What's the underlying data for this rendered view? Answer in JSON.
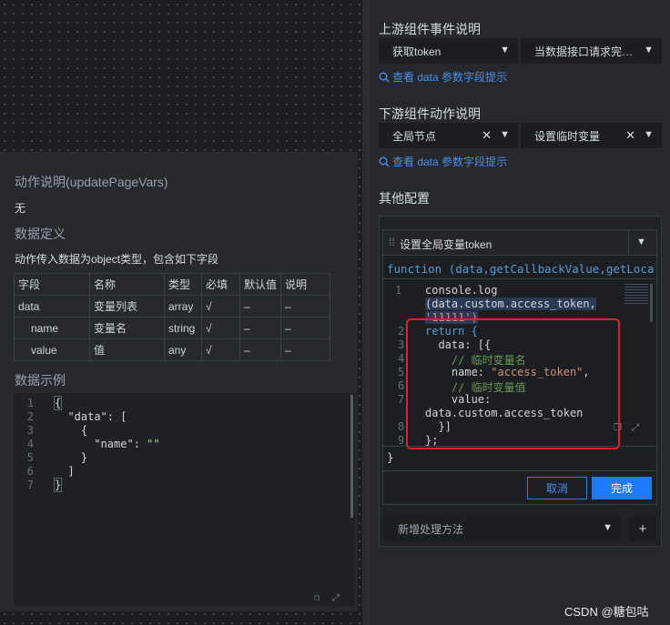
{
  "upstream": {
    "title": "上游组件事件说明",
    "select1": "获取token",
    "select2": "当数据接口请求完…",
    "link": "查看 data 参数字段提示"
  },
  "downstream": {
    "title": "下游组件动作说明",
    "select1": "全局节点",
    "select2": "设置临时变量",
    "link": "查看 data 参数字段提示"
  },
  "other": {
    "title": "其他配置",
    "editor_title": "设置全局变量token",
    "signature": "function (data,getCallbackValue,getLocalV",
    "closing_brace": "}",
    "cancel": "取消",
    "confirm": "完成",
    "add_method": "新增处理方法",
    "add_symbol": "+"
  },
  "code": {
    "line_numbers": [
      "1",
      "2",
      "3",
      "4",
      "5",
      "6",
      "7",
      "8",
      "9"
    ],
    "l1a": "console.log",
    "l1b": "(data.custom.access_token,",
    "l1c": "'11111')",
    "l2": "return {",
    "l3": "  data: [{",
    "l4": "    // 临时变量名",
    "l5a": "    name: ",
    "l5b": "\"access_token\"",
    "l5c": ",",
    "l6": "    // 临时变量值",
    "l7a": "    value:",
    "l7b": "data.custom.access_token",
    "l8": "  }]",
    "l9": "};"
  },
  "doc": {
    "action_title": "动作说明(updatePageVars)",
    "action_desc": "无",
    "def_title": "数据定义",
    "def_desc": "动作传入数据为object类型，包含如下字段",
    "headers": [
      "字段",
      "名称",
      "类型",
      "必填",
      "默认值",
      "说明"
    ],
    "rows": [
      [
        "data",
        "变量列表",
        "array",
        "√",
        "–",
        "–"
      ],
      [
        "name",
        "变量名",
        "string",
        "√",
        "–",
        "–"
      ],
      [
        "value",
        "值",
        "any",
        "√",
        "–",
        "–"
      ]
    ],
    "example_title": "数据示例",
    "example_lines": [
      "1",
      "2",
      "3",
      "4",
      "5",
      "6",
      "7"
    ],
    "ex1": "{",
    "ex2a": "  \"data\"",
    "ex2b": ": [",
    "ex3": "    {",
    "ex4a": "      \"name\"",
    "ex4b": ": ",
    "ex4c": "\"\"",
    "ex5": "    }",
    "ex6": "  ]",
    "ex7": "}"
  },
  "watermark": "CSDN @糖包咕"
}
